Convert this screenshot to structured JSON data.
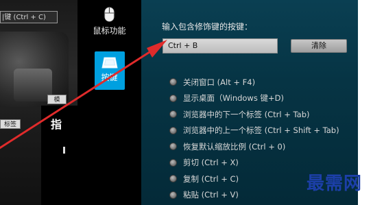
{
  "left": {
    "tooltip": "|键 (Ctrl + C)",
    "mini_tag": "标签",
    "mini_button": "模",
    "lower_text": "指"
  },
  "sidebar": {
    "items": [
      {
        "label": "鼠标功能",
        "icon": "mouse-icon"
      },
      {
        "label": "按键",
        "icon": "key-icon",
        "selected": true
      }
    ],
    "selected_color": "#00a0e0"
  },
  "panel": {
    "title": "输入包含修饰键的按键：",
    "input_value": "Ctrl + B",
    "clear_label": "清除",
    "options": [
      {
        "label": "关闭窗口 (Alt + F4)"
      },
      {
        "label": "显示桌面（Windows 键+D)"
      },
      {
        "label": "浏览器中的下一个标签 (Ctrl + Tab)"
      },
      {
        "label": "浏览器中的上一个标签 (Ctrl + Shift + Tab)"
      },
      {
        "label": "恢复默认缩放比例 (Ctrl + 0)"
      },
      {
        "label": "剪切 (Ctrl + X)"
      },
      {
        "label": "复制 (Ctrl + C)"
      },
      {
        "label": "粘贴 (Ctrl + V)"
      }
    ]
  },
  "watermark": "最需网",
  "colors": {
    "arrow": "#e02b2b",
    "panel_bg": "#063444",
    "accent": "#00a0e0"
  }
}
